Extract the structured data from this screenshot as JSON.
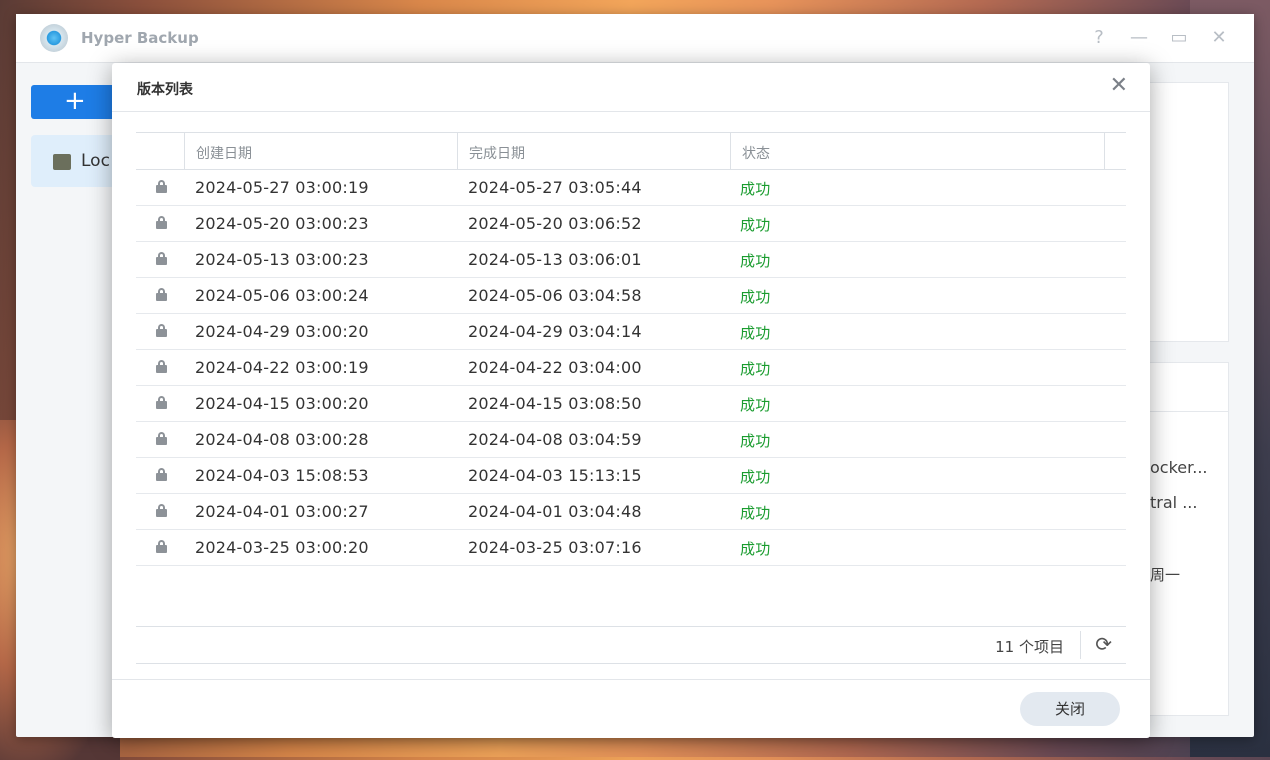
{
  "app": {
    "title": "Hyper Backup",
    "window_controls": {
      "help": "?",
      "minimize": "—",
      "maximize": "▭",
      "close": "✕"
    },
    "add_button": "+",
    "sidebar_item": "Loc",
    "background_fragments": [
      "ocker...",
      "tral ...",
      "周一"
    ]
  },
  "dialog": {
    "title": "版本列表",
    "close_icon": "✕",
    "columns": [
      "创建日期",
      "完成日期",
      "状态"
    ],
    "rows": [
      {
        "created": "2024-05-27 03:00:19",
        "completed": "2024-05-27 03:05:44",
        "status": "成功"
      },
      {
        "created": "2024-05-20 03:00:23",
        "completed": "2024-05-20 03:06:52",
        "status": "成功"
      },
      {
        "created": "2024-05-13 03:00:23",
        "completed": "2024-05-13 03:06:01",
        "status": "成功"
      },
      {
        "created": "2024-05-06 03:00:24",
        "completed": "2024-05-06 03:04:58",
        "status": "成功"
      },
      {
        "created": "2024-04-29 03:00:20",
        "completed": "2024-04-29 03:04:14",
        "status": "成功"
      },
      {
        "created": "2024-04-22 03:00:19",
        "completed": "2024-04-22 03:04:00",
        "status": "成功"
      },
      {
        "created": "2024-04-15 03:00:20",
        "completed": "2024-04-15 03:08:50",
        "status": "成功"
      },
      {
        "created": "2024-04-08 03:00:28",
        "completed": "2024-04-08 03:04:59",
        "status": "成功"
      },
      {
        "created": "2024-04-03 15:08:53",
        "completed": "2024-04-03 15:13:15",
        "status": "成功"
      },
      {
        "created": "2024-04-01 03:00:27",
        "completed": "2024-04-01 03:04:48",
        "status": "成功"
      },
      {
        "created": "2024-03-25 03:00:20",
        "completed": "2024-03-25 03:07:16",
        "status": "成功"
      }
    ],
    "item_count": "11 个项目",
    "refresh_icon": "⟳",
    "close_button": "关闭",
    "status_color": "#1a9c2f"
  }
}
